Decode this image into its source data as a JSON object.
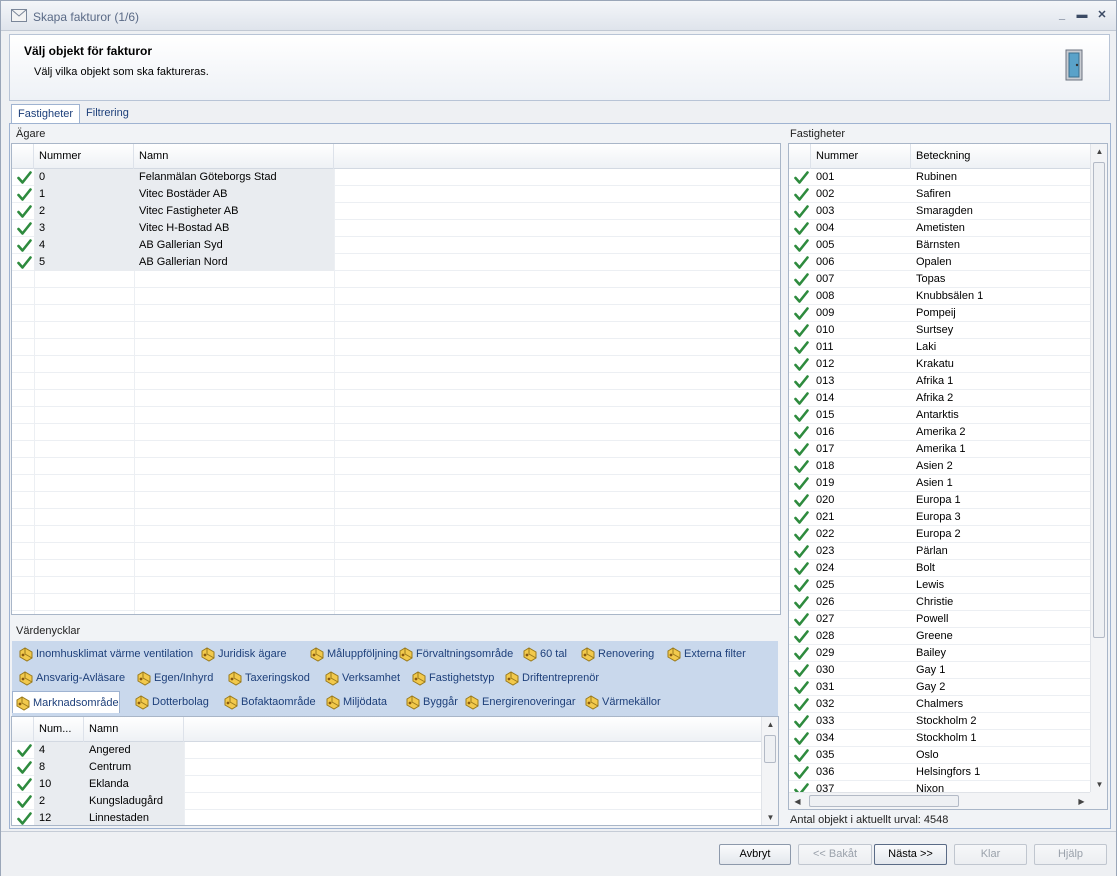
{
  "window": {
    "title": "Skapa fakturor (1/6)"
  },
  "header": {
    "title": "Välj objekt för fakturor",
    "subtitle": "Välj vilka objekt som ska faktureras."
  },
  "tabs": [
    {
      "label": "Fastigheter",
      "active": true
    },
    {
      "label": "Filtrering",
      "active": false
    }
  ],
  "owners": {
    "label": "Ägare",
    "columns": [
      "Nummer",
      "Namn"
    ],
    "rows": [
      {
        "num": "0",
        "name": "Felanmälan Göteborgs Stad"
      },
      {
        "num": "1",
        "name": "Vitec Bostäder AB"
      },
      {
        "num": "2",
        "name": "Vitec Fastigheter AB"
      },
      {
        "num": "3",
        "name": "Vitec H-Bostad AB"
      },
      {
        "num": "4",
        "name": "AB Gallerian Syd"
      },
      {
        "num": "5",
        "name": "AB Gallerian Nord"
      }
    ]
  },
  "value_keys": {
    "label": "Värdenycklar",
    "row1": [
      "Inomhusklimat värme ventilation",
      "Juridisk ägare",
      "Måluppföljning",
      "Förvaltningsområde",
      "60 tal",
      "Renovering",
      "Externa filter"
    ],
    "row2": [
      "Ansvarig-Avläsare",
      "Egen/Inhyrd",
      "Taxeringskod",
      "Verksamhet",
      "Fastighetstyp",
      "Driftentreprenör"
    ],
    "row3": [
      "Marknadsområde",
      "Dotterbolag",
      "Bofaktaområde",
      "Miljödata",
      "Byggår",
      "Energirenoveringar",
      "Värmekällor"
    ],
    "active": "Marknadsområde"
  },
  "markets": {
    "columns": [
      "Num...",
      "Namn"
    ],
    "rows": [
      {
        "num": "4",
        "name": "Angered"
      },
      {
        "num": "8",
        "name": "Centrum"
      },
      {
        "num": "10",
        "name": "Eklanda"
      },
      {
        "num": "2",
        "name": "Kungsladugård"
      },
      {
        "num": "12",
        "name": "Linnestaden"
      }
    ]
  },
  "properties": {
    "label": "Fastigheter",
    "columns": [
      "Nummer",
      "Beteckning"
    ],
    "rows": [
      {
        "num": "001",
        "name": "Rubinen"
      },
      {
        "num": "002",
        "name": "Safiren"
      },
      {
        "num": "003",
        "name": "Smaragden"
      },
      {
        "num": "004",
        "name": "Ametisten"
      },
      {
        "num": "005",
        "name": "Bärnsten"
      },
      {
        "num": "006",
        "name": "Opalen"
      },
      {
        "num": "007",
        "name": "Topas"
      },
      {
        "num": "008",
        "name": "Knubbsälen 1"
      },
      {
        "num": "009",
        "name": "Pompeij"
      },
      {
        "num": "010",
        "name": "Surtsey"
      },
      {
        "num": "011",
        "name": "Laki"
      },
      {
        "num": "012",
        "name": "Krakatu"
      },
      {
        "num": "013",
        "name": "Afrika 1"
      },
      {
        "num": "014",
        "name": "Afrika 2"
      },
      {
        "num": "015",
        "name": "Antarktis"
      },
      {
        "num": "016",
        "name": "Amerika 2"
      },
      {
        "num": "017",
        "name": "Amerika 1"
      },
      {
        "num": "018",
        "name": "Asien 2"
      },
      {
        "num": "019",
        "name": "Asien 1"
      },
      {
        "num": "020",
        "name": "Europa 1"
      },
      {
        "num": "021",
        "name": "Europa 3"
      },
      {
        "num": "022",
        "name": "Europa 2"
      },
      {
        "num": "023",
        "name": "Pärlan"
      },
      {
        "num": "024",
        "name": "Bolt"
      },
      {
        "num": "025",
        "name": "Lewis"
      },
      {
        "num": "026",
        "name": "Christie"
      },
      {
        "num": "027",
        "name": "Powell"
      },
      {
        "num": "028",
        "name": "Greene"
      },
      {
        "num": "029",
        "name": "Bailey"
      },
      {
        "num": "030",
        "name": "Gay 1"
      },
      {
        "num": "031",
        "name": "Gay 2"
      },
      {
        "num": "032",
        "name": "Chalmers"
      },
      {
        "num": "033",
        "name": "Stockholm 2"
      },
      {
        "num": "034",
        "name": "Stockholm 1"
      },
      {
        "num": "035",
        "name": "Oslo"
      },
      {
        "num": "036",
        "name": "Helsingfors 1"
      },
      {
        "num": "037",
        "name": "Nixon"
      }
    ],
    "status": "Antal objekt i aktuellt urval: 4548"
  },
  "buttons": {
    "cancel": "Avbryt",
    "back": "<< Bakåt",
    "next": "Nästa >>",
    "finish": "Klar",
    "help": "Hjälp"
  },
  "colors": {
    "check": "#2e8b3e",
    "accent": "#1d3f7a",
    "keys_bg": "#c9d8ec"
  }
}
